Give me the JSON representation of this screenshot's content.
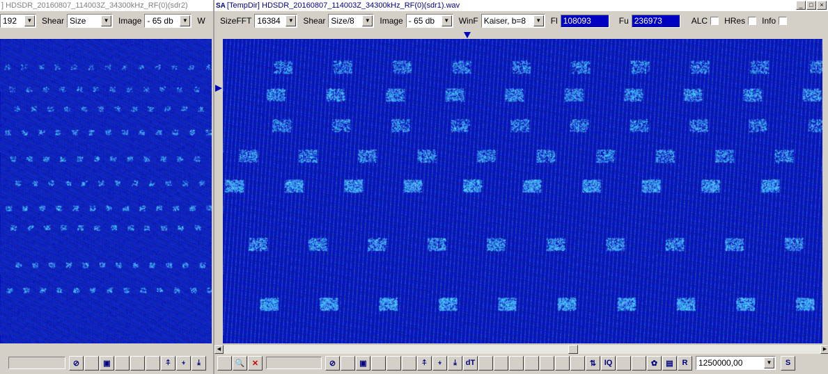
{
  "left_window": {
    "title": "] HDSDR_20160807_114003Z_34300kHz_RF(0)(sdr2)",
    "controls": {
      "size_fft_value": "192",
      "shear_label": "Shear",
      "shear_value": "Size",
      "image_label": "Image",
      "image_value": "- 65 db",
      "w_label": "W"
    }
  },
  "right_window": {
    "icon_text": "SA",
    "title": "[TempDir] HDSDR_20160807_114003Z_34300kHz_RF(0)(sdr1).wav",
    "window_buttons": [
      "_",
      "□",
      "×"
    ],
    "controls": {
      "size_fft_label": "SizeFFT",
      "size_fft_value": "16384",
      "shear_label": "Shear",
      "shear_value": "Size/8",
      "image_label": "Image",
      "image_value": "- 65 db",
      "winf_label": "WinF",
      "winf_value": "Kaiser, b=8",
      "fl_label": "Fl",
      "fl_value": "108093",
      "fu_label": "Fu",
      "fu_value": "236973",
      "alc_label": "ALC",
      "hres_label": "HRes",
      "info_label": "Info"
    },
    "toolbar": {
      "buttons": [
        {
          "name": "blank-tool-icon",
          "glyph": ""
        },
        {
          "name": "zoom-icon",
          "glyph": "🔍"
        },
        {
          "name": "cancel-x-icon",
          "glyph": "✕"
        },
        {
          "name": "stop-icon",
          "glyph": "⊘"
        },
        {
          "name": "blank-tool-icon",
          "glyph": ""
        },
        {
          "name": "frame-icon",
          "glyph": "▣"
        },
        {
          "name": "blank-tool-icon",
          "glyph": ""
        },
        {
          "name": "blank-tool-icon",
          "glyph": ""
        },
        {
          "name": "blank-tool-icon",
          "glyph": ""
        },
        {
          "name": "arrow-up-icon",
          "glyph": "⍏"
        },
        {
          "name": "arrow-down-icon",
          "glyph": "⍖"
        },
        {
          "name": "arrow-down-bar-icon",
          "glyph": "⤓"
        },
        {
          "name": "dt-icon",
          "glyph": "dT"
        },
        {
          "name": "blank-tool-icon",
          "glyph": ""
        },
        {
          "name": "blank-tool-icon",
          "glyph": ""
        },
        {
          "name": "blank-tool-icon",
          "glyph": ""
        },
        {
          "name": "blank-tool-icon",
          "glyph": ""
        },
        {
          "name": "blank-tool-icon",
          "glyph": ""
        },
        {
          "name": "blank-tool-icon",
          "glyph": ""
        },
        {
          "name": "blank-tool-icon",
          "glyph": ""
        },
        {
          "name": "swap-vertical-icon",
          "glyph": "⇅"
        },
        {
          "name": "iq-icon",
          "glyph": "IQ"
        },
        {
          "name": "blank-tool-icon",
          "glyph": ""
        },
        {
          "name": "blank-tool-icon",
          "glyph": ""
        },
        {
          "name": "gear-icon",
          "glyph": "✿"
        },
        {
          "name": "clipboard-icon",
          "glyph": "▤"
        },
        {
          "name": "r-icon",
          "glyph": "R"
        }
      ],
      "rate_value": "1250000,00",
      "s_button": "S"
    }
  },
  "colors": {
    "spectrum_bg": "#0a14c8",
    "signal": "#40c0ff",
    "marker": "#0000c0",
    "numbox": "#0000c0"
  }
}
